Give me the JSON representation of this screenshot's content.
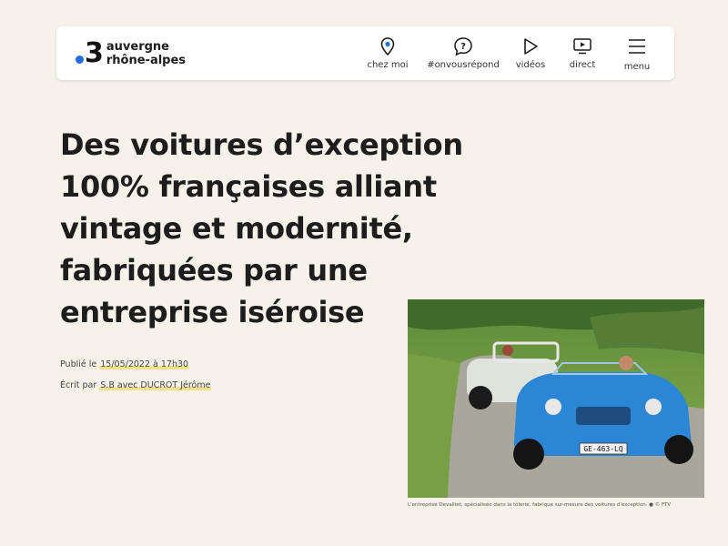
{
  "header": {
    "logo_number": "3",
    "logo_line1": "auvergne",
    "logo_line2": "rhône-alpes",
    "nav": [
      {
        "label": "chez moi",
        "icon": "location-pin-icon"
      },
      {
        "label": "#onvousrépond",
        "icon": "question-bubble-icon"
      },
      {
        "label": "vidéos",
        "icon": "play-icon"
      },
      {
        "label": "direct",
        "icon": "tv-play-icon"
      },
      {
        "label": "menu",
        "icon": "hamburger-menu-icon"
      }
    ]
  },
  "article": {
    "headline_lines": [
      "Des voitures d’exception",
      "100% françaises alliant",
      "vintage et modernité,",
      "fabriquées par une",
      "entreprise iséroise"
    ],
    "published_prefix": "Publié le ",
    "published_date": "15/05/2022 à 17h30",
    "author_prefix": "Écrit par ",
    "author_names": "S.B avec DUCROT Jérôme",
    "photo": {
      "plate": "GE-463-LQ",
      "caption": "L'entreprise Devalliet, spécialisée dans la tôlerie, fabrique sur-mesure des voitures d'exception. ● © FTV"
    }
  },
  "colors": {
    "background": "#f6f2ea",
    "logo_dot": "#1f6fdc",
    "highlight": "#f3e08a",
    "car_front": "#2c86d6",
    "car_back": "#dfe3dc"
  }
}
